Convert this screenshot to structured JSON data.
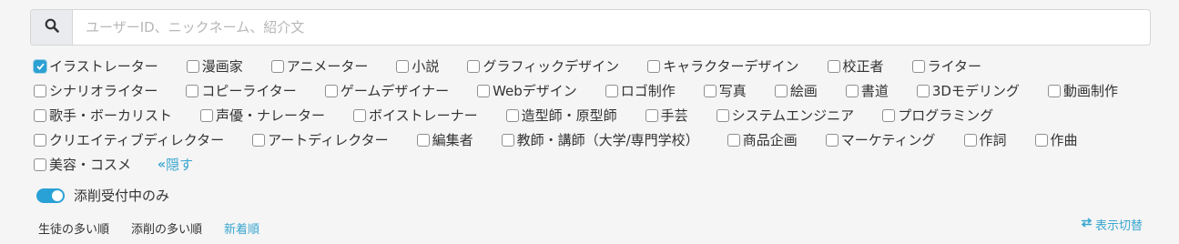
{
  "search": {
    "placeholder": "ユーザーID、ニックネーム、紹介文",
    "value": ""
  },
  "categories": [
    {
      "label": "イラストレーター",
      "checked": true
    },
    {
      "label": "漫画家",
      "checked": false
    },
    {
      "label": "アニメーター",
      "checked": false
    },
    {
      "label": "小説",
      "checked": false
    },
    {
      "label": "グラフィックデザイン",
      "checked": false
    },
    {
      "label": "キャラクターデザイン",
      "checked": false
    },
    {
      "label": "校正者",
      "checked": false
    },
    {
      "label": "ライター",
      "checked": false
    },
    {
      "label": "シナリオライター",
      "checked": false
    },
    {
      "label": "コピーライター",
      "checked": false
    },
    {
      "label": "ゲームデザイナー",
      "checked": false
    },
    {
      "label": "Webデザイン",
      "checked": false
    },
    {
      "label": "ロゴ制作",
      "checked": false
    },
    {
      "label": "写真",
      "checked": false
    },
    {
      "label": "絵画",
      "checked": false
    },
    {
      "label": "書道",
      "checked": false
    },
    {
      "label": "3Dモデリング",
      "checked": false
    },
    {
      "label": "動画制作",
      "checked": false
    },
    {
      "label": "歌手・ボーカリスト",
      "checked": false
    },
    {
      "label": "声優・ナレーター",
      "checked": false
    },
    {
      "label": "ボイストレーナー",
      "checked": false
    },
    {
      "label": "造型師・原型師",
      "checked": false
    },
    {
      "label": "手芸",
      "checked": false
    },
    {
      "label": "システムエンジニア",
      "checked": false
    },
    {
      "label": "プログラミング",
      "checked": false
    },
    {
      "label": "クリエイティブディレクター",
      "checked": false
    },
    {
      "label": "アートディレクター",
      "checked": false
    },
    {
      "label": "編集者",
      "checked": false
    },
    {
      "label": "教師・講師（大学/専門学校）",
      "checked": false
    },
    {
      "label": "商品企画",
      "checked": false
    },
    {
      "label": "マーケティング",
      "checked": false
    },
    {
      "label": "作詞",
      "checked": false
    },
    {
      "label": "作曲",
      "checked": false
    },
    {
      "label": "美容・コスメ",
      "checked": false
    }
  ],
  "hide_link": {
    "label": "隠す",
    "icon": "double-chevron-left-icon"
  },
  "toggle": {
    "label": "添削受付中のみ",
    "on": true
  },
  "sort_options": [
    {
      "label": "生徒の多い順",
      "active": false
    },
    {
      "label": "添削の多い順",
      "active": false
    },
    {
      "label": "新着順",
      "active": true
    }
  ],
  "view_toggle": {
    "label": "表示切替",
    "icon": "swap-arrows-icon"
  },
  "colors": {
    "accent": "#2aa1d6",
    "link": "#3aa6cf",
    "search_button_bg": "#e9ebee",
    "page_bg": "#f5f5f5"
  }
}
